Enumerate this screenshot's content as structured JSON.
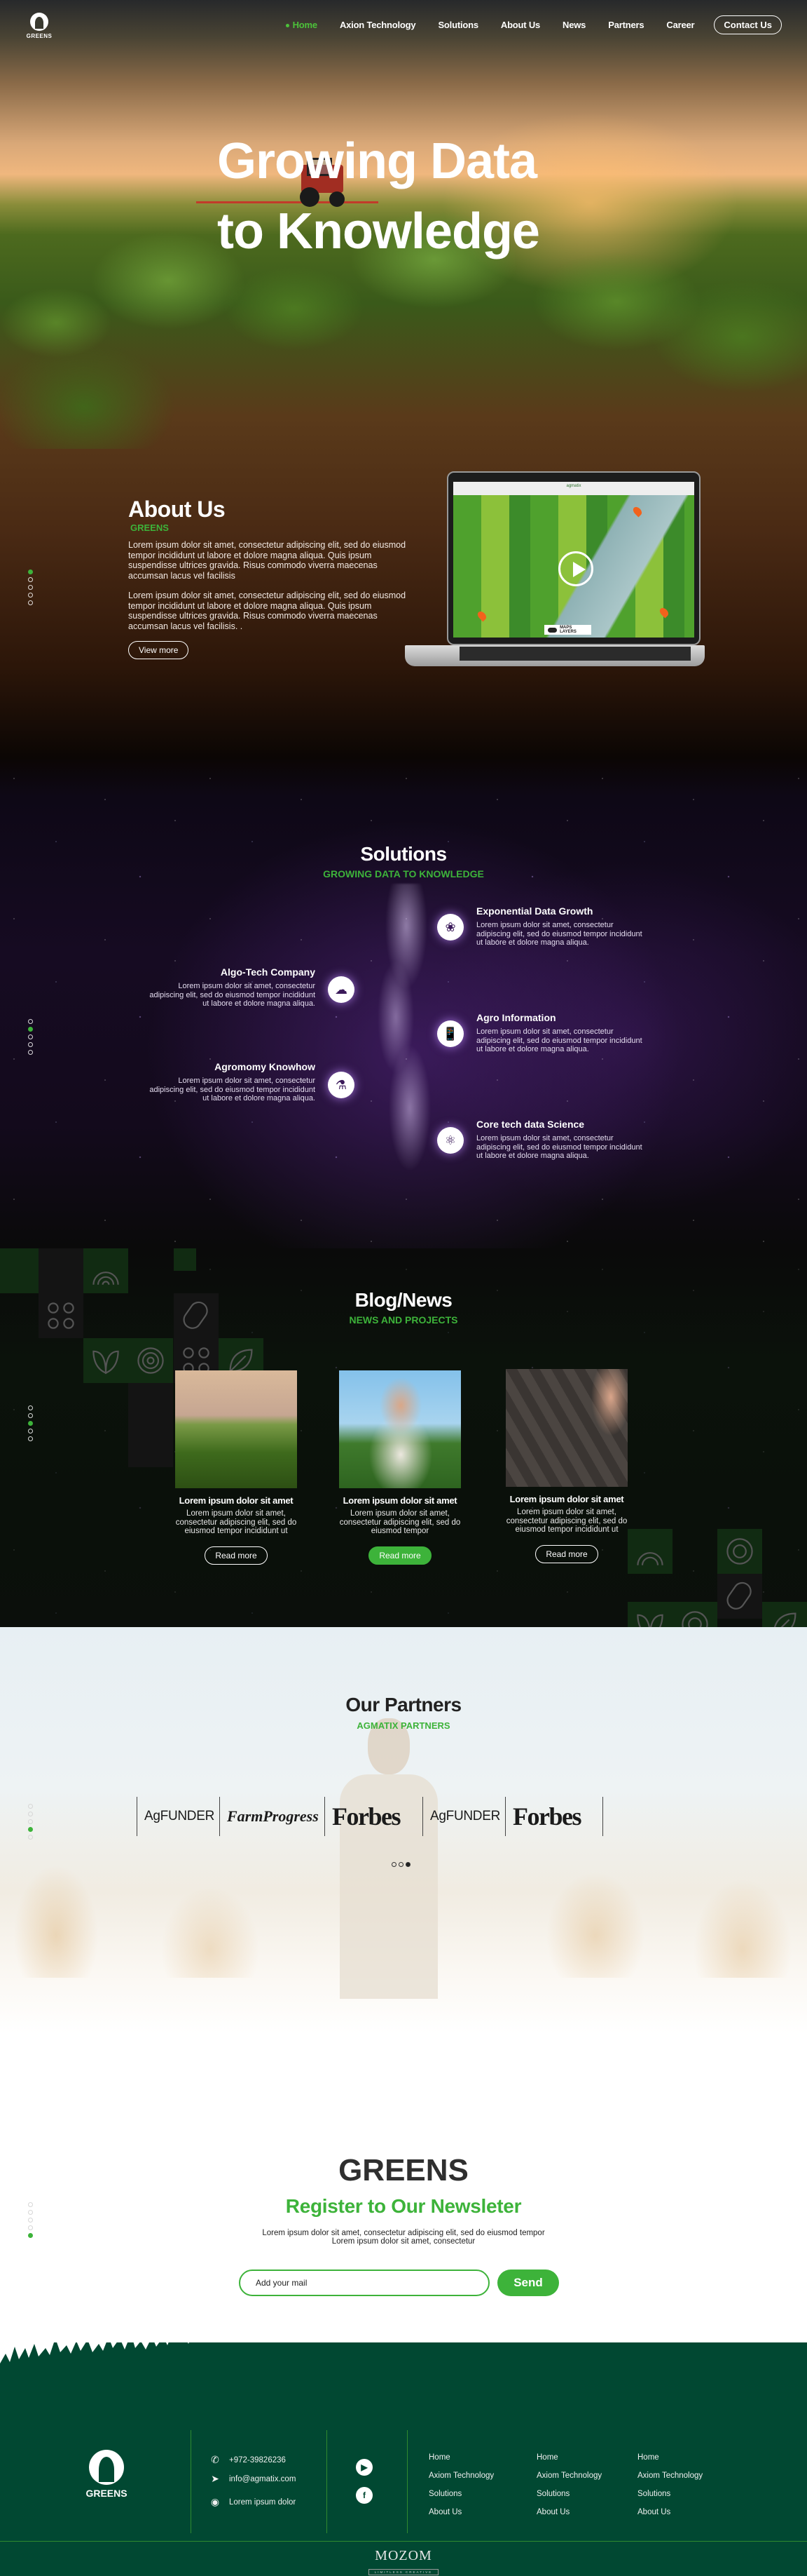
{
  "brand": {
    "name": "GREENS",
    "accent_color": "#3db33a",
    "footer_bg": "#014832"
  },
  "nav": {
    "items": [
      {
        "label": "Home",
        "active": true
      },
      {
        "label": "Axion Technology",
        "active": false
      },
      {
        "label": "Solutions",
        "active": false
      },
      {
        "label": "About Us",
        "active": false
      },
      {
        "label": "News",
        "active": false
      },
      {
        "label": "Partners",
        "active": false
      },
      {
        "label": "Career",
        "active": false
      }
    ],
    "contact_label": "Contact Us"
  },
  "hero": {
    "title_line1": "Growing Data",
    "title_line2": "to Knowledge"
  },
  "about": {
    "title": "About Us",
    "subtitle": "GREENS",
    "paragraphs": [
      "Lorem ipsum dolor sit amet, consectetur adipiscing elit, sed do eiusmod tempor incididunt ut labore et dolore magna aliqua. Quis ipsum suspendisse ultrices gravida. Risus commodo viverra maecenas accumsan lacus vel facilisis",
      "Lorem ipsum dolor sit amet, consectetur adipiscing elit, sed do eiusmod tempor incididunt ut labore et dolore magna aliqua. Quis ipsum suspendisse ultrices gravida. Risus commodo viverra maecenas accumsan lacus vel facilisis. ."
    ],
    "button_label": "View more",
    "laptop": {
      "app_name": "agmatix",
      "toggle_label": "MAPS LAYERS",
      "video_icon": "play-icon",
      "pin_icon": "map-pin-icon"
    }
  },
  "section_dots": {
    "about": {
      "count": 5,
      "active": 0
    },
    "solutions": {
      "count": 5,
      "active": 1
    },
    "blog": {
      "count": 5,
      "active": 2
    },
    "partners": {
      "count": 5,
      "active": 3
    },
    "newsletter": {
      "count": 5,
      "active": 4
    }
  },
  "solutions": {
    "title": "Solutions",
    "subtitle": "GROWING DATA TO KNOWLEDGE",
    "items": [
      {
        "title": "Exponential Data Growth",
        "text": "Lorem ipsum dolor sit amet, consectetur adipiscing elit, sed do eiusmod tempor incididunt ut labore et dolore magna aliqua.",
        "icon": "plant-circuit-icon",
        "side": "right"
      },
      {
        "title": "Algo-Tech Company",
        "text": "Lorem ipsum dolor sit amet, consectetur adipiscing elit, sed do eiusmod tempor incididunt ut labore et dolore magna aliqua.",
        "icon": "cloud-server-icon",
        "side": "left"
      },
      {
        "title": "Agro Information",
        "text": "Lorem ipsum dolor sit amet, consectetur adipiscing elit, sed do eiusmod tempor incididunt ut labore et dolore magna aliqua.",
        "icon": "mobile-leaf-icon",
        "side": "right"
      },
      {
        "title": "Agromomy Knowhow",
        "text": "Lorem ipsum dolor sit amet, consectetur adipiscing elit, sed do eiusmod tempor incididunt ut labore et dolore magna aliqua.",
        "icon": "test-tube-plant-icon",
        "side": "left"
      },
      {
        "title": "Core tech data Science",
        "text": "Lorem ipsum dolor sit amet, consectetur adipiscing elit, sed do eiusmod tempor incididunt ut labore et dolore magna aliqua.",
        "icon": "molecule-network-icon",
        "side": "right"
      }
    ]
  },
  "blog": {
    "title": "Blog/News",
    "subtitle": "NEWS AND PROJECTS",
    "cards": [
      {
        "title": "Lorem ipsum dolor sit amet",
        "text": "Lorem ipsum dolor sit amet, consectetur adipiscing elit, sed do eiusmod tempor incididunt ut",
        "button": "Read more",
        "active": false,
        "image": "tractor-field-photo"
      },
      {
        "title": "Lorem ipsum dolor sit amet",
        "text": "Lorem ipsum dolor sit amet, consectetur adipiscing elit, sed do eiusmod tempor",
        "button": "Read more",
        "active": true,
        "image": "farmer-corn-photo"
      },
      {
        "title": "Lorem ipsum dolor sit amet",
        "text": "Lorem ipsum dolor sit amet, consectetur adipiscing elit, sed do eiusmod tempor incididunt ut",
        "button": "Read more",
        "active": false,
        "image": "planting-seeds-photo"
      }
    ]
  },
  "partners": {
    "title": "Our Partners",
    "subtitle": "AGMATIX PARTNERS",
    "logos": [
      "AgFUNDER",
      "FarmProgress",
      "Forbes",
      "AgFUNDER",
      "Forbes"
    ],
    "carousel": {
      "count": 3,
      "active": 2
    }
  },
  "newsletter": {
    "brand": "GREENS",
    "title": "Register to Our Newsleter",
    "text_line1": "Lorem ipsum dolor sit amet, consectetur adipiscing elit, sed do eiusmod tempor",
    "text_line2": "Lorem ipsum dolor sit amet, consectetur",
    "input_placeholder": "Add your mail",
    "button_label": "Send"
  },
  "footer": {
    "brand": "GREENS",
    "phone": "+972-39826236",
    "email": "info@agmatix.com",
    "address": "Lorem ipsum dolor",
    "social": [
      "youtube-icon",
      "facebook-icon"
    ],
    "columns": [
      [
        "Home",
        "Axiom Technology",
        "Solutions",
        "About Us"
      ],
      [
        "Home",
        "Axiom Technology",
        "Solutions",
        "About Us"
      ],
      [
        "Home",
        "Axiom Technology",
        "Solutions",
        "About Us"
      ]
    ],
    "credit_name": "MOZOM",
    "credit_tag": "LIMITLESS CREATIVE"
  }
}
